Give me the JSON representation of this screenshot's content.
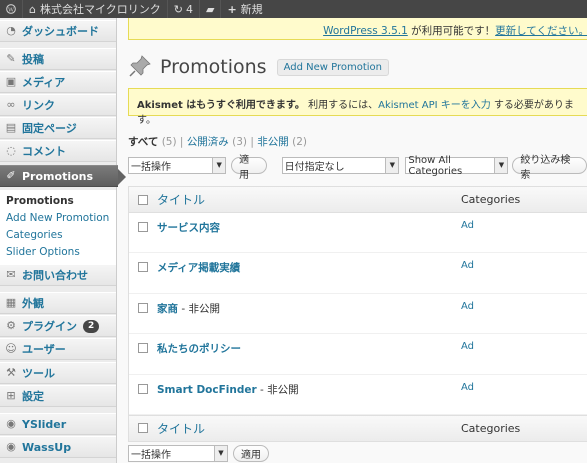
{
  "adminbar": {
    "site_name": "株式会社マイクロリンク",
    "updates_count": "4",
    "new_label": "新規"
  },
  "sidebar": {
    "items": [
      {
        "icon": "dashboard-icon",
        "glyph": "◔",
        "label": "ダッシュボード"
      },
      {
        "icon": "posts-icon",
        "glyph": "✎",
        "label": "投稿"
      },
      {
        "icon": "media-icon",
        "glyph": "▣",
        "label": "メディア"
      },
      {
        "icon": "links-icon",
        "glyph": "∞",
        "label": "リンク"
      },
      {
        "icon": "pages-icon",
        "glyph": "▤",
        "label": "固定ページ"
      },
      {
        "icon": "comments-icon",
        "glyph": "◌",
        "label": "コメント"
      },
      {
        "icon": "promotions-icon",
        "glyph": "✐",
        "label": "Promotions"
      },
      {
        "icon": "contact-icon",
        "glyph": "✉",
        "label": "お問い合わせ"
      },
      {
        "icon": "appearance-icon",
        "glyph": "▦",
        "label": "外観"
      },
      {
        "icon": "plugins-icon",
        "glyph": "⚙",
        "label": "プラグイン",
        "badge": "2"
      },
      {
        "icon": "users-icon",
        "glyph": "☺",
        "label": "ユーザー"
      },
      {
        "icon": "tools-icon",
        "glyph": "⚒",
        "label": "ツール"
      },
      {
        "icon": "settings-icon",
        "glyph": "⊞",
        "label": "設定"
      },
      {
        "icon": "yslider-icon",
        "glyph": "◉",
        "label": "YSlider"
      },
      {
        "icon": "wassup-icon",
        "glyph": "◉",
        "label": "WassUp"
      }
    ],
    "submenu": [
      "Promotions",
      "Add New Promotion",
      "Categories",
      "Slider Options"
    ]
  },
  "update_nag": {
    "text": "WordPress 3.5.1",
    "text2": " が利用可能です！",
    "link": "更新してください。"
  },
  "page": {
    "title": "Promotions",
    "add_new": "Add New Promotion"
  },
  "akismet": {
    "bold": "Akismet はもうすぐ利用できます。",
    "text": " 利用するには、",
    "link": "Akismet API キーを入力",
    "text2": " する必要があります。"
  },
  "filters": {
    "all": "すべて",
    "all_count": "(5)",
    "published": "公開済み",
    "published_count": "(3)",
    "private": "非公開",
    "private_count": "(2)"
  },
  "toolbar": {
    "bulk_action": "一括操作",
    "apply": "適用",
    "date_filter": "日付指定なし",
    "category_filter": "Show All Categories",
    "filter_button": "絞り込み検索"
  },
  "table": {
    "col_title": "タイトル",
    "col_categories": "Categories",
    "rows": [
      {
        "title": "サービス内容",
        "state": "",
        "category": "Ad"
      },
      {
        "title": "メディア掲載実績",
        "state": "",
        "category": "Ad"
      },
      {
        "title": "家商",
        "state": " - 非公開",
        "category": "Ad"
      },
      {
        "title": "私たちのポリシー",
        "state": "",
        "category": "Ad"
      },
      {
        "title": "Smart DocFinder",
        "state": " - 非公開",
        "category": "Ad"
      }
    ]
  }
}
